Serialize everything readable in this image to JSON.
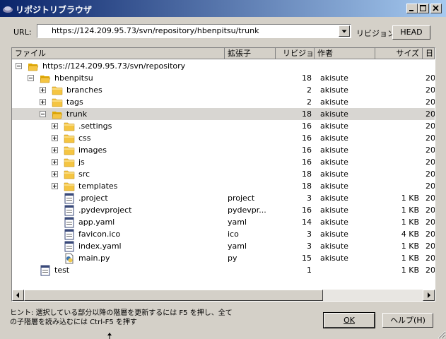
{
  "window": {
    "title": "リポジトリブラウザ"
  },
  "url": {
    "label": "URL:",
    "value": "https://124.209.95.73/svn/repository/hbenpitsu/trunk"
  },
  "revision": {
    "label": "リビジョン:",
    "button": "HEAD"
  },
  "columns": {
    "file": "ファイル",
    "ext": "拡張子",
    "rev": "リビジョン",
    "author": "作者",
    "size": "サイズ",
    "date": "日"
  },
  "rows": [
    {
      "name": "https://124.209.95.73/svn/repository",
      "ext": "",
      "rev": "",
      "author": "",
      "size": "",
      "date": "",
      "level": 0,
      "expander": "minus",
      "icon": "folder-open-icon"
    },
    {
      "name": "hbenpitsu",
      "ext": "",
      "rev": "18",
      "author": "akisute",
      "size": "",
      "date": "20",
      "level": 1,
      "expander": "minus",
      "icon": "folder-open-icon"
    },
    {
      "name": "branches",
      "ext": "",
      "rev": "2",
      "author": "akisute",
      "size": "",
      "date": "20",
      "level": 2,
      "expander": "plus",
      "icon": "folder-icon"
    },
    {
      "name": "tags",
      "ext": "",
      "rev": "2",
      "author": "akisute",
      "size": "",
      "date": "20",
      "level": 2,
      "expander": "plus",
      "icon": "folder-icon"
    },
    {
      "name": "trunk",
      "ext": "",
      "rev": "18",
      "author": "akisute",
      "size": "",
      "date": "20",
      "level": 2,
      "expander": "minus",
      "icon": "folder-open-icon",
      "selected": true
    },
    {
      "name": ".settings",
      "ext": "",
      "rev": "16",
      "author": "akisute",
      "size": "",
      "date": "20",
      "level": 3,
      "expander": "plus",
      "icon": "folder-icon"
    },
    {
      "name": "css",
      "ext": "",
      "rev": "16",
      "author": "akisute",
      "size": "",
      "date": "20",
      "level": 3,
      "expander": "plus",
      "icon": "folder-icon"
    },
    {
      "name": "images",
      "ext": "",
      "rev": "16",
      "author": "akisute",
      "size": "",
      "date": "20",
      "level": 3,
      "expander": "plus",
      "icon": "folder-icon"
    },
    {
      "name": "js",
      "ext": "",
      "rev": "16",
      "author": "akisute",
      "size": "",
      "date": "20",
      "level": 3,
      "expander": "plus",
      "icon": "folder-icon"
    },
    {
      "name": "src",
      "ext": "",
      "rev": "18",
      "author": "akisute",
      "size": "",
      "date": "20",
      "level": 3,
      "expander": "plus",
      "icon": "folder-icon"
    },
    {
      "name": "templates",
      "ext": "",
      "rev": "18",
      "author": "akisute",
      "size": "",
      "date": "20",
      "level": 3,
      "expander": "plus",
      "icon": "folder-icon"
    },
    {
      "name": ".project",
      "ext": "project",
      "rev": "3",
      "author": "akisute",
      "size": "1 KB",
      "date": "20",
      "level": 3,
      "expander": "none",
      "icon": "file-icon"
    },
    {
      "name": ".pydevproject",
      "ext": "pydevpr...",
      "rev": "16",
      "author": "akisute",
      "size": "1 KB",
      "date": "20",
      "level": 3,
      "expander": "none",
      "icon": "file-icon"
    },
    {
      "name": "app.yaml",
      "ext": "yaml",
      "rev": "14",
      "author": "akisute",
      "size": "1 KB",
      "date": "20",
      "level": 3,
      "expander": "none",
      "icon": "file-icon"
    },
    {
      "name": "favicon.ico",
      "ext": "ico",
      "rev": "3",
      "author": "akisute",
      "size": "4 KB",
      "date": "20",
      "level": 3,
      "expander": "none",
      "icon": "file-icon"
    },
    {
      "name": "index.yaml",
      "ext": "yaml",
      "rev": "3",
      "author": "akisute",
      "size": "1 KB",
      "date": "20",
      "level": 3,
      "expander": "none",
      "icon": "file-icon"
    },
    {
      "name": "main.py",
      "ext": "py",
      "rev": "15",
      "author": "akisute",
      "size": "1 KB",
      "date": "20",
      "level": 3,
      "expander": "none",
      "icon": "python-file-icon"
    },
    {
      "name": "test",
      "ext": "",
      "rev": "1",
      "author": "",
      "size": "1 KB",
      "date": "20",
      "level": 1,
      "expander": "none",
      "icon": "file-icon"
    }
  ],
  "hint": {
    "line1": "ヒント: 選択している部分以降の階層を更新するには F5 を押し、全て",
    "line2": "の子階層を読み込むには Ctrl-F5 を押す"
  },
  "buttons": {
    "ok": "OK",
    "help": "ヘルプ(H)"
  },
  "colors": {
    "titlebar_start": "#0a246a",
    "titlebar_end": "#a6caf0",
    "folder": "#f5c542",
    "selected_row": "#d8d6d2"
  }
}
